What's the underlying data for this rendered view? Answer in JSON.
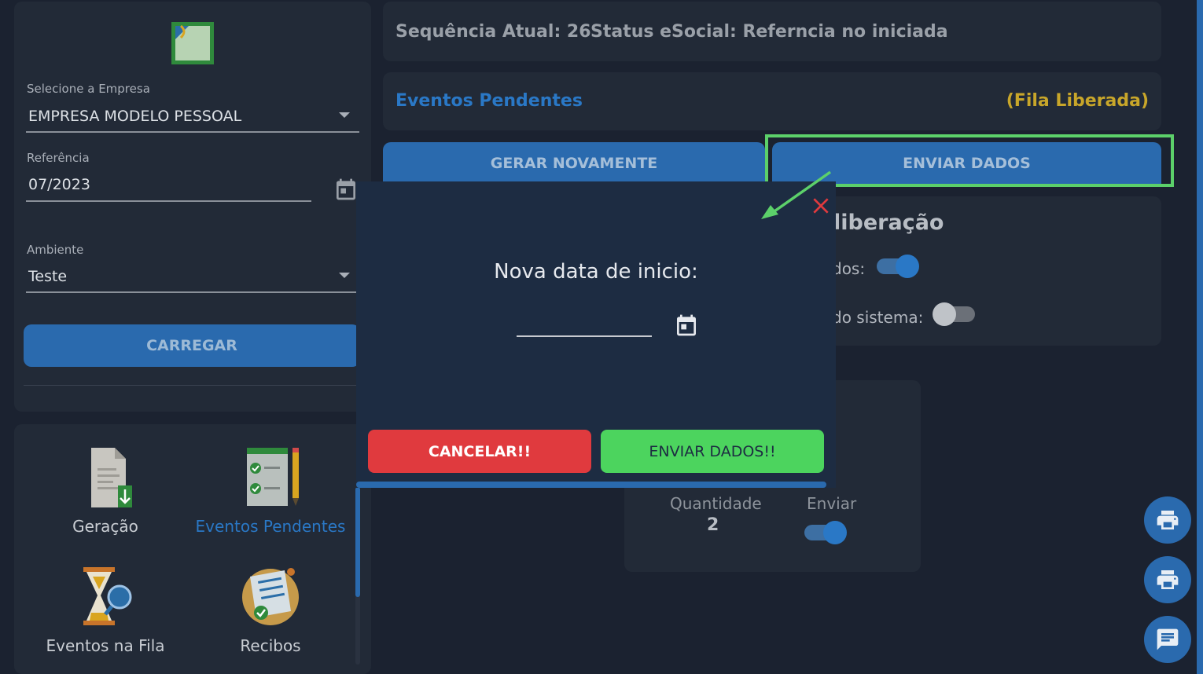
{
  "sidebar": {
    "empresa_label": "Selecione a Empresa",
    "empresa_value": "EMPRESA MODELO PESSOAL",
    "referencia_label": "Referência",
    "referencia_value": "07/2023",
    "ambiente_label": "Ambiente",
    "ambiente_value": "Teste",
    "carregar_label": "CARREGAR"
  },
  "menu": [
    {
      "label": "Geração",
      "icon": "document-download-icon"
    },
    {
      "label": "Eventos Pendentes",
      "icon": "checklist-pencil-icon",
      "active": true
    },
    {
      "label": "Eventos na Fila",
      "icon": "hourglass-search-icon"
    },
    {
      "label": "Recibos",
      "icon": "receipt-check-icon"
    }
  ],
  "status": {
    "sequencia": "Sequência Atual: 26",
    "esocial": "Status eSocial: Refernciа no iniciada"
  },
  "eventos": {
    "title": "Eventos Pendentes",
    "fila": "(Fila Liberada)"
  },
  "actions": {
    "gerar_label": "GERAR NOVAMENTE",
    "enviar_label": "ENVIAR DADOS"
  },
  "config": {
    "title": "liberação",
    "row1_label": "dos:",
    "row1_on": true,
    "row2_label": "do sistema:",
    "row2_on": false
  },
  "count": {
    "quantidade_label": "Quantidade",
    "quantidade_value": "2",
    "enviar_label": "Enviar",
    "enviar_on": true
  },
  "modal": {
    "title": "Nova data de inicio:",
    "date_value": "",
    "cancel_label": "CANCELAR!!",
    "send_label": "ENVIAR DADOS!!"
  },
  "colors": {
    "accent": "#2a6aae",
    "highlight": "#5cd06a",
    "cancel": "#e03a3e",
    "send": "#4cd45e",
    "fila": "#c8a62a"
  },
  "fab": [
    "printer-icon",
    "printer-icon",
    "chat-icon"
  ]
}
